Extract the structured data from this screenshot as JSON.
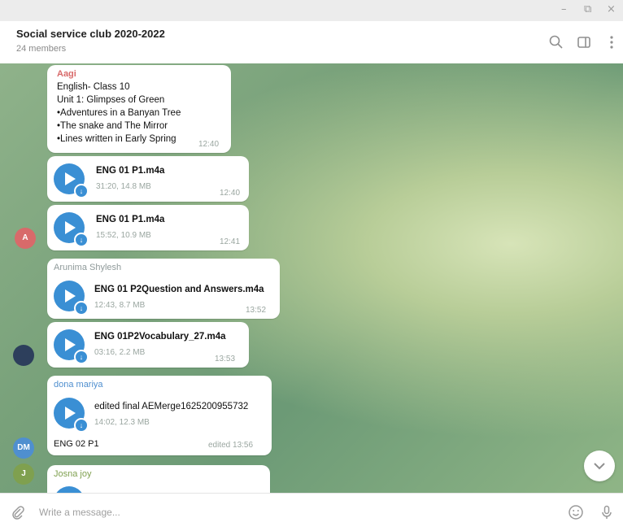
{
  "window": {
    "minimize": "–",
    "maximize": "⧉",
    "close": "×"
  },
  "header": {
    "title": "Social service club 2020-2022",
    "subtitle": "24 members"
  },
  "messages": [
    {
      "sender": "Aagi",
      "lines": [
        "English- Class 10",
        "Unit 1: Glimpses of Green",
        "•Adventures in a Banyan Tree",
        "•The snake and The Mirror",
        "•Lines written in Early Spring"
      ],
      "time": "12:40"
    },
    {
      "file": "ENG 01 P1.m4a",
      "meta": "31:20, 14.8 MB",
      "time": "12:40"
    },
    {
      "file": "ENG 01 P1.m4a",
      "meta": "15:52, 10.9 MB",
      "time": "12:41"
    },
    {
      "sender": "Arunima Shylesh",
      "file": "ENG 01 P2Question and Answers.m4a",
      "meta": "12:43, 8.7 MB",
      "time": "13:52"
    },
    {
      "file": "ENG 01P2Vocabulary_27.m4a",
      "meta": "03:16, 2.2 MB",
      "time": "13:53"
    },
    {
      "sender": "dona mariya",
      "file": "edited final AEMerge1625200955732",
      "meta": "14:02, 12.3 MB",
      "caption": "ENG 02 P1",
      "time": "edited 13:56"
    },
    {
      "sender": "Josna joy"
    }
  ],
  "avatars": {
    "aagi": "A",
    "dona": "DM",
    "josna": "J"
  },
  "colors": {
    "accent": "#3a8fd4",
    "aagi": "#d86a6a",
    "arunima": "#8f9a9a",
    "dona": "#4f8fcf",
    "josna": "#7fa04f"
  },
  "composer": {
    "placeholder": "Write a message..."
  }
}
